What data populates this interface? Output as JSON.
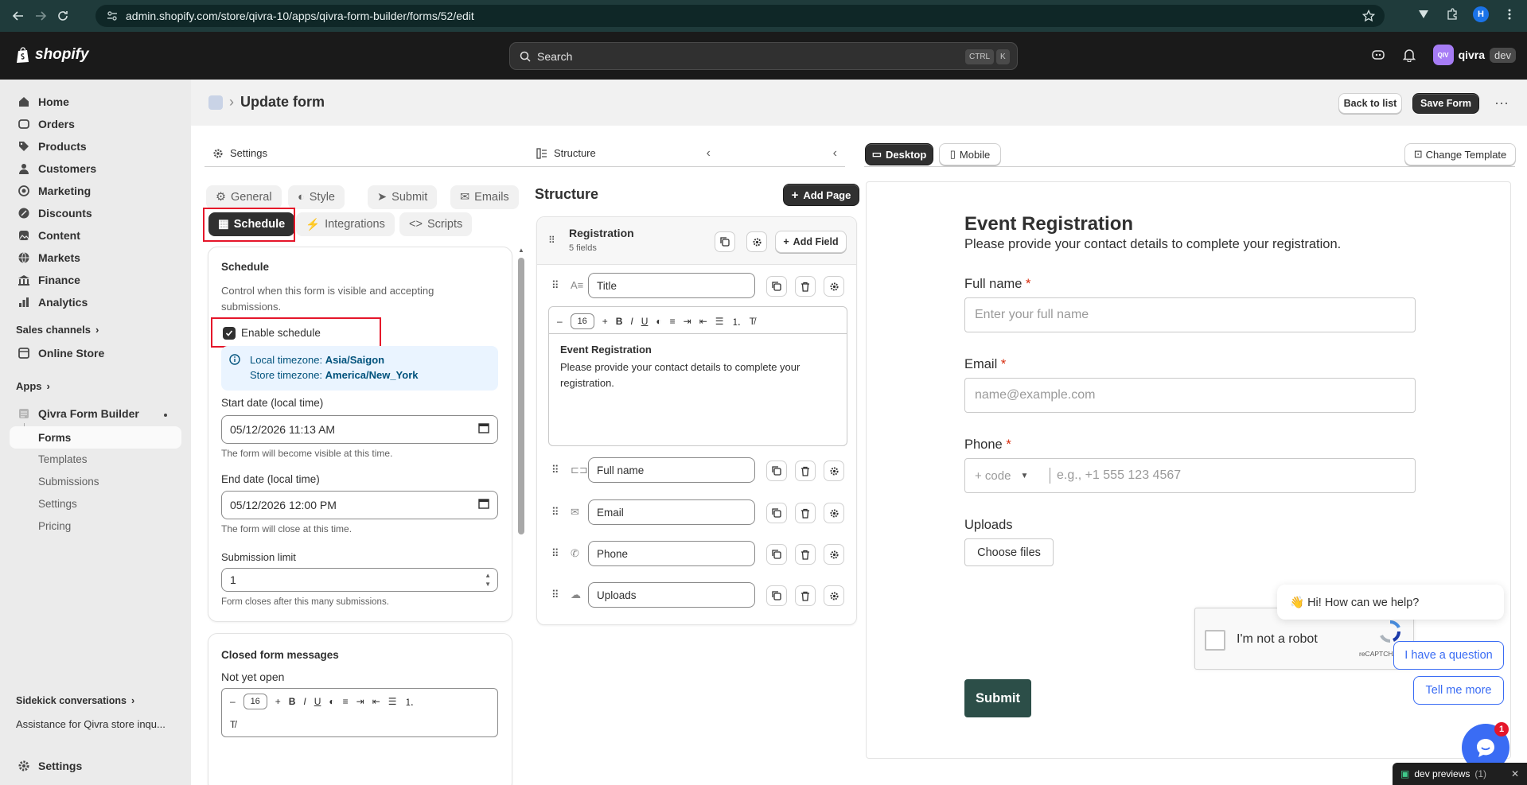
{
  "browser": {
    "url": "admin.shopify.com/store/qivra-10/apps/qivra-form-builder/forms/52/edit",
    "profile_initial": "H"
  },
  "topbar": {
    "logo_text": "shopify",
    "search_placeholder": "Search",
    "kbd_ctrl": "CTRL",
    "kbd_k": "K",
    "store_avatar": "QIV",
    "store_name": "qivra",
    "store_tag": "dev"
  },
  "sidebar": {
    "items": [
      {
        "label": "Home",
        "icon": "home-icon"
      },
      {
        "label": "Orders",
        "icon": "orders-icon"
      },
      {
        "label": "Products",
        "icon": "tag-icon"
      },
      {
        "label": "Customers",
        "icon": "person-icon"
      },
      {
        "label": "Marketing",
        "icon": "target-icon"
      },
      {
        "label": "Discounts",
        "icon": "discount-icon"
      },
      {
        "label": "Content",
        "icon": "image-icon"
      },
      {
        "label": "Markets",
        "icon": "globe-icon"
      },
      {
        "label": "Finance",
        "icon": "bank-icon"
      },
      {
        "label": "Analytics",
        "icon": "chart-icon"
      }
    ],
    "sales_channels_label": "Sales channels",
    "online_store_label": "Online Store",
    "apps_label": "Apps",
    "app_name": "Qivra Form Builder",
    "app_subitems": [
      "Forms",
      "Templates",
      "Submissions",
      "Settings",
      "Pricing"
    ],
    "sidekick_label": "Sidekick conversations",
    "sidekick_item": "Assistance for Qivra store inqu...",
    "settings_label": "Settings"
  },
  "page": {
    "title": "Update form",
    "back_button": "Back to list",
    "save_button": "Save Form"
  },
  "settings_panel": {
    "title": "Settings",
    "tabs_row1": [
      "General",
      "Style",
      "Submit",
      "Emails"
    ],
    "tabs_row2": [
      "Schedule",
      "Integrations",
      "Scripts"
    ],
    "schedule": {
      "heading": "Schedule",
      "description": "Control when this form is visible and accepting submissions.",
      "enable_label": "Enable schedule",
      "enabled": true,
      "local_tz_label": "Local timezone:",
      "local_tz_value": "Asia/Saigon",
      "store_tz_label": "Store timezone:",
      "store_tz_value": "America/New_York",
      "start_label": "Start date (local time)",
      "start_value": "05/12/2026 11:13 AM",
      "start_help": "The form will become visible at this time.",
      "end_label": "End date (local time)",
      "end_value": "05/12/2026 12:00 PM",
      "end_help": "The form will close at this time.",
      "limit_label": "Submission limit",
      "limit_value": "1",
      "limit_help": "Form closes after this many submissions."
    },
    "closed_messages": {
      "heading": "Closed form messages",
      "not_yet_open_label": "Not yet open",
      "font_size": "16"
    }
  },
  "structure_panel": {
    "title": "Structure",
    "heading": "Structure",
    "add_page_button": "Add Page",
    "page_name": "Registration",
    "page_fields_count": "5 fields",
    "add_field_button": "Add Field",
    "title_field": "Title",
    "editor_font_size": "16",
    "editor_heading": "Event Registration",
    "editor_body": "Please provide your contact details to complete your registration.",
    "fields": [
      "Full name",
      "Email",
      "Phone",
      "Uploads"
    ]
  },
  "preview": {
    "desktop_label": "Desktop",
    "mobile_label": "Mobile",
    "change_template_label": "Change Template",
    "form_title": "Event Registration",
    "form_subtitle": "Please provide your contact details to complete your registration.",
    "fullname_label": "Full name",
    "fullname_placeholder": "Enter your full name",
    "email_label": "Email",
    "email_placeholder": "name@example.com",
    "phone_label": "Phone",
    "phone_code_placeholder": "+ code",
    "phone_placeholder": "e.g., +1 555 123 4567",
    "uploads_label": "Uploads",
    "choose_files": "Choose files",
    "captcha_label": "I'm not a robot",
    "captcha_brand": "reCAPTCHA",
    "submit_label": "Submit",
    "required_mark": "*"
  },
  "chat": {
    "greeting": "👋 Hi! How can we help?",
    "question_button": "I have a question",
    "tell_more_button": "Tell me more",
    "badge_count": "1"
  },
  "dev_bar": {
    "label": "dev previews",
    "count": "(1)"
  }
}
